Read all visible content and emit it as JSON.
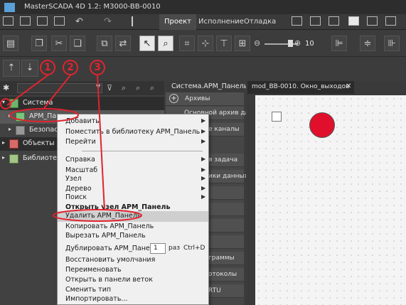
{
  "window": {
    "title": "MasterSCADA 4D 1.2: M3000-BB-0010"
  },
  "ribbon": {
    "tabs": [
      "Проект",
      "Исполнение",
      "Отладка"
    ],
    "active": "Проект"
  },
  "toolbar": {
    "zoom_value": "10"
  },
  "tree": {
    "items": [
      {
        "label": "Система"
      },
      {
        "label": "АРМ_Панель"
      },
      {
        "label": "Безопасн"
      },
      {
        "label": "Объекты"
      },
      {
        "label": "Библиотеки"
      }
    ]
  },
  "middle": {
    "header": "Система.АРМ_Панель",
    "rows": [
      "Архивы",
      "Основной архив дан",
      "е каналы",
      "я задача",
      "ики данных",
      "граммы",
      "отоколы",
      "RTU"
    ]
  },
  "editor": {
    "tab_label": "mod_BB-0010. Окно_выходов",
    "close": "✕"
  },
  "context_menu": {
    "items": [
      {
        "label": "Добавить",
        "submenu": true
      },
      {
        "label": "Поместить в библиотеку АРМ_Панель",
        "submenu": true
      },
      {
        "label": "Перейти",
        "submenu": true
      },
      {
        "label": "Справка",
        "submenu": true
      },
      {
        "label": "Масштаб",
        "submenu": true
      },
      {
        "label": "Узел",
        "submenu": true
      },
      {
        "label": "Дерево",
        "submenu": true
      },
      {
        "label": "Поиск",
        "submenu": true
      },
      {
        "label": "Открыть узел АРМ_Панель",
        "bold": true
      },
      {
        "label": "Удалить АРМ_Панель",
        "highlight": true
      },
      {
        "label": "Копировать АРМ_Панель"
      },
      {
        "label": "Вырезать АРМ_Панель"
      },
      {
        "label": "Дублировать АРМ_Панель"
      },
      {
        "label": "Восстановить умолчания"
      },
      {
        "label": "Переименовать"
      },
      {
        "label": "Открыть в панели веток"
      },
      {
        "label": "Сменить тип"
      },
      {
        "label": "Импортировать..."
      }
    ],
    "duplicate_count": "1",
    "duplicate_unit": "раз",
    "duplicate_shortcut": "Ctrl+D"
  },
  "annotations": [
    "1",
    "2",
    "3"
  ],
  "colors": {
    "annotation_red": "#e0242e",
    "canvas_circle": "#e0102c"
  }
}
